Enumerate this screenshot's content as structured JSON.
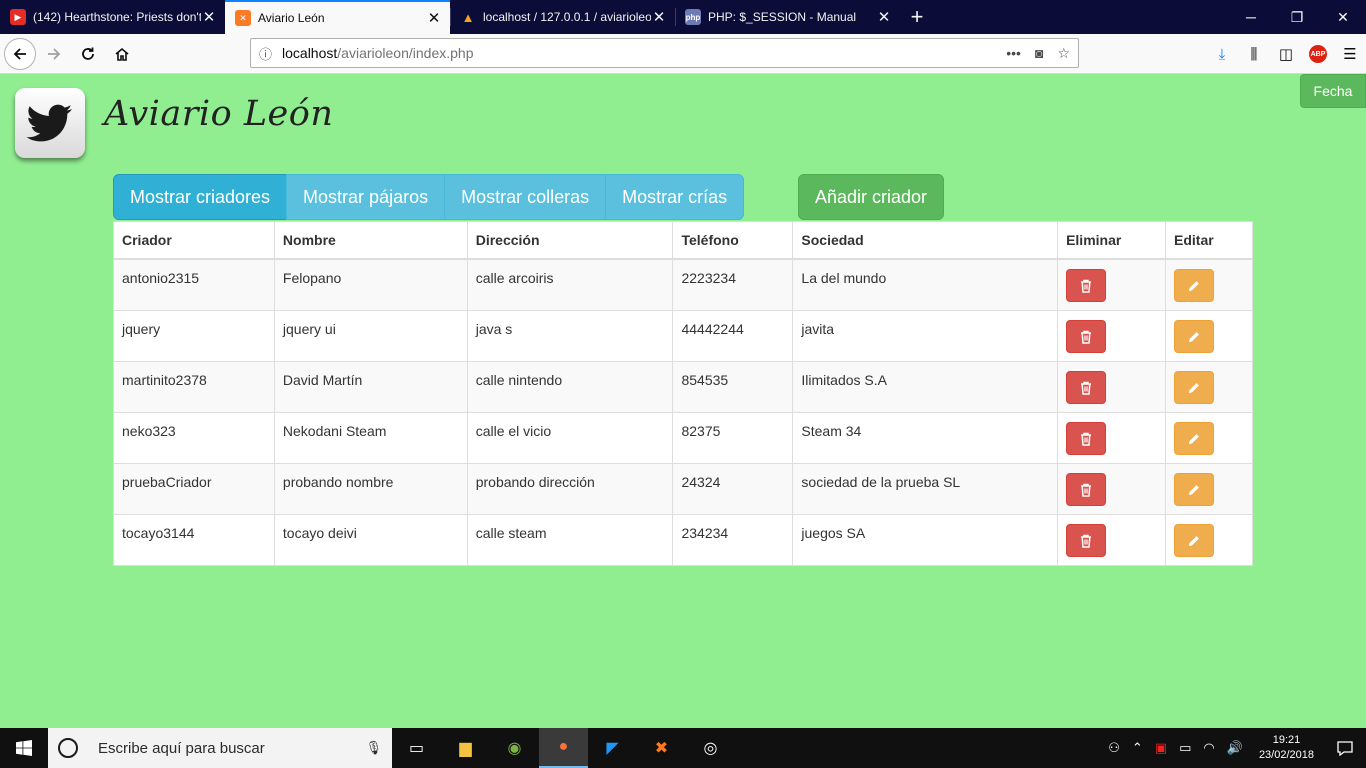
{
  "browser": {
    "tabs": [
      {
        "title": "(142) Hearthstone: Priests don't",
        "favicon": "youtube-icon",
        "active": false
      },
      {
        "title": "Aviario León",
        "favicon": "xampp-icon",
        "active": true
      },
      {
        "title": "localhost / 127.0.0.1 / aviarioleo",
        "favicon": "phpmyadmin-icon",
        "active": false
      },
      {
        "title": "PHP: $_SESSION - Manual",
        "favicon": "php-icon",
        "active": false
      }
    ],
    "url_host": "localhost",
    "url_path": "/aviarioleon/index.php"
  },
  "page": {
    "brand": "Aviario León",
    "fecha_label": "Fecha",
    "nav_buttons": [
      "Mostrar criadores",
      "Mostrar pájaros",
      "Mostrar colleras",
      "Mostrar crías"
    ],
    "add_button": "Añadir criador"
  },
  "table": {
    "headers": [
      "Criador",
      "Nombre",
      "Dirección",
      "Teléfono",
      "Sociedad",
      "Eliminar",
      "Editar"
    ],
    "rows": [
      [
        "antonio2315",
        "Felopano",
        "calle arcoiris",
        "2223234",
        "La del mundo"
      ],
      [
        "jquery",
        "jquery ui",
        "java s",
        "44442244",
        "javita"
      ],
      [
        "martinito2378",
        "David Martín",
        "calle nintendo",
        "854535",
        "Ilimitados S.A"
      ],
      [
        "neko323",
        "Nekodani Steam",
        "calle el vicio",
        "82375",
        "Steam 34"
      ],
      [
        "pruebaCriador",
        "probando nombre",
        "probando dirección",
        "24324",
        "sociedad de la prueba SL"
      ],
      [
        "tocayo3144",
        "tocayo deivi",
        "calle steam",
        "234234",
        "juegos SA"
      ]
    ]
  },
  "taskbar": {
    "search_placeholder": "Escribe aquí para buscar",
    "time": "19:21",
    "date": "23/02/2018"
  },
  "colors": {
    "page_background": "#90ee90",
    "info": "#5bc0de",
    "success": "#5cb85c",
    "danger": "#d9534f",
    "warning": "#f0ad4e"
  }
}
